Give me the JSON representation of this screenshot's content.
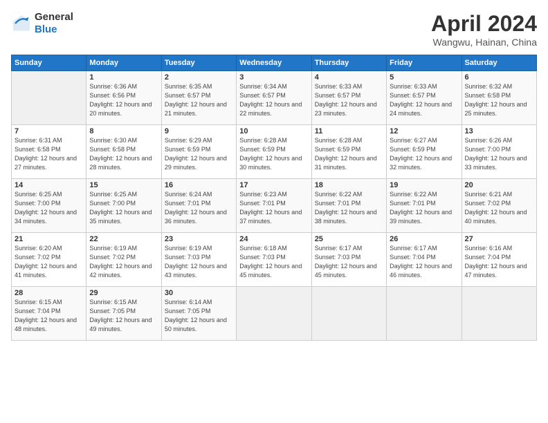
{
  "header": {
    "logo_general": "General",
    "logo_blue": "Blue",
    "title": "April 2024",
    "location": "Wangwu, Hainan, China"
  },
  "weekdays": [
    "Sunday",
    "Monday",
    "Tuesday",
    "Wednesday",
    "Thursday",
    "Friday",
    "Saturday"
  ],
  "weeks": [
    [
      {
        "day": "",
        "sunrise": "",
        "sunset": "",
        "daylight": ""
      },
      {
        "day": "1",
        "sunrise": "Sunrise: 6:36 AM",
        "sunset": "Sunset: 6:56 PM",
        "daylight": "Daylight: 12 hours and 20 minutes."
      },
      {
        "day": "2",
        "sunrise": "Sunrise: 6:35 AM",
        "sunset": "Sunset: 6:57 PM",
        "daylight": "Daylight: 12 hours and 21 minutes."
      },
      {
        "day": "3",
        "sunrise": "Sunrise: 6:34 AM",
        "sunset": "Sunset: 6:57 PM",
        "daylight": "Daylight: 12 hours and 22 minutes."
      },
      {
        "day": "4",
        "sunrise": "Sunrise: 6:33 AM",
        "sunset": "Sunset: 6:57 PM",
        "daylight": "Daylight: 12 hours and 23 minutes."
      },
      {
        "day": "5",
        "sunrise": "Sunrise: 6:33 AM",
        "sunset": "Sunset: 6:57 PM",
        "daylight": "Daylight: 12 hours and 24 minutes."
      },
      {
        "day": "6",
        "sunrise": "Sunrise: 6:32 AM",
        "sunset": "Sunset: 6:58 PM",
        "daylight": "Daylight: 12 hours and 25 minutes."
      }
    ],
    [
      {
        "day": "7",
        "sunrise": "Sunrise: 6:31 AM",
        "sunset": "Sunset: 6:58 PM",
        "daylight": "Daylight: 12 hours and 27 minutes."
      },
      {
        "day": "8",
        "sunrise": "Sunrise: 6:30 AM",
        "sunset": "Sunset: 6:58 PM",
        "daylight": "Daylight: 12 hours and 28 minutes."
      },
      {
        "day": "9",
        "sunrise": "Sunrise: 6:29 AM",
        "sunset": "Sunset: 6:59 PM",
        "daylight": "Daylight: 12 hours and 29 minutes."
      },
      {
        "day": "10",
        "sunrise": "Sunrise: 6:28 AM",
        "sunset": "Sunset: 6:59 PM",
        "daylight": "Daylight: 12 hours and 30 minutes."
      },
      {
        "day": "11",
        "sunrise": "Sunrise: 6:28 AM",
        "sunset": "Sunset: 6:59 PM",
        "daylight": "Daylight: 12 hours and 31 minutes."
      },
      {
        "day": "12",
        "sunrise": "Sunrise: 6:27 AM",
        "sunset": "Sunset: 6:59 PM",
        "daylight": "Daylight: 12 hours and 32 minutes."
      },
      {
        "day": "13",
        "sunrise": "Sunrise: 6:26 AM",
        "sunset": "Sunset: 7:00 PM",
        "daylight": "Daylight: 12 hours and 33 minutes."
      }
    ],
    [
      {
        "day": "14",
        "sunrise": "Sunrise: 6:25 AM",
        "sunset": "Sunset: 7:00 PM",
        "daylight": "Daylight: 12 hours and 34 minutes."
      },
      {
        "day": "15",
        "sunrise": "Sunrise: 6:25 AM",
        "sunset": "Sunset: 7:00 PM",
        "daylight": "Daylight: 12 hours and 35 minutes."
      },
      {
        "day": "16",
        "sunrise": "Sunrise: 6:24 AM",
        "sunset": "Sunset: 7:01 PM",
        "daylight": "Daylight: 12 hours and 36 minutes."
      },
      {
        "day": "17",
        "sunrise": "Sunrise: 6:23 AM",
        "sunset": "Sunset: 7:01 PM",
        "daylight": "Daylight: 12 hours and 37 minutes."
      },
      {
        "day": "18",
        "sunrise": "Sunrise: 6:22 AM",
        "sunset": "Sunset: 7:01 PM",
        "daylight": "Daylight: 12 hours and 38 minutes."
      },
      {
        "day": "19",
        "sunrise": "Sunrise: 6:22 AM",
        "sunset": "Sunset: 7:01 PM",
        "daylight": "Daylight: 12 hours and 39 minutes."
      },
      {
        "day": "20",
        "sunrise": "Sunrise: 6:21 AM",
        "sunset": "Sunset: 7:02 PM",
        "daylight": "Daylight: 12 hours and 40 minutes."
      }
    ],
    [
      {
        "day": "21",
        "sunrise": "Sunrise: 6:20 AM",
        "sunset": "Sunset: 7:02 PM",
        "daylight": "Daylight: 12 hours and 41 minutes."
      },
      {
        "day": "22",
        "sunrise": "Sunrise: 6:19 AM",
        "sunset": "Sunset: 7:02 PM",
        "daylight": "Daylight: 12 hours and 42 minutes."
      },
      {
        "day": "23",
        "sunrise": "Sunrise: 6:19 AM",
        "sunset": "Sunset: 7:03 PM",
        "daylight": "Daylight: 12 hours and 43 minutes."
      },
      {
        "day": "24",
        "sunrise": "Sunrise: 6:18 AM",
        "sunset": "Sunset: 7:03 PM",
        "daylight": "Daylight: 12 hours and 45 minutes."
      },
      {
        "day": "25",
        "sunrise": "Sunrise: 6:17 AM",
        "sunset": "Sunset: 7:03 PM",
        "daylight": "Daylight: 12 hours and 45 minutes."
      },
      {
        "day": "26",
        "sunrise": "Sunrise: 6:17 AM",
        "sunset": "Sunset: 7:04 PM",
        "daylight": "Daylight: 12 hours and 46 minutes."
      },
      {
        "day": "27",
        "sunrise": "Sunrise: 6:16 AM",
        "sunset": "Sunset: 7:04 PM",
        "daylight": "Daylight: 12 hours and 47 minutes."
      }
    ],
    [
      {
        "day": "28",
        "sunrise": "Sunrise: 6:15 AM",
        "sunset": "Sunset: 7:04 PM",
        "daylight": "Daylight: 12 hours and 48 minutes."
      },
      {
        "day": "29",
        "sunrise": "Sunrise: 6:15 AM",
        "sunset": "Sunset: 7:05 PM",
        "daylight": "Daylight: 12 hours and 49 minutes."
      },
      {
        "day": "30",
        "sunrise": "Sunrise: 6:14 AM",
        "sunset": "Sunset: 7:05 PM",
        "daylight": "Daylight: 12 hours and 50 minutes."
      },
      {
        "day": "",
        "sunrise": "",
        "sunset": "",
        "daylight": ""
      },
      {
        "day": "",
        "sunrise": "",
        "sunset": "",
        "daylight": ""
      },
      {
        "day": "",
        "sunrise": "",
        "sunset": "",
        "daylight": ""
      },
      {
        "day": "",
        "sunrise": "",
        "sunset": "",
        "daylight": ""
      }
    ]
  ]
}
